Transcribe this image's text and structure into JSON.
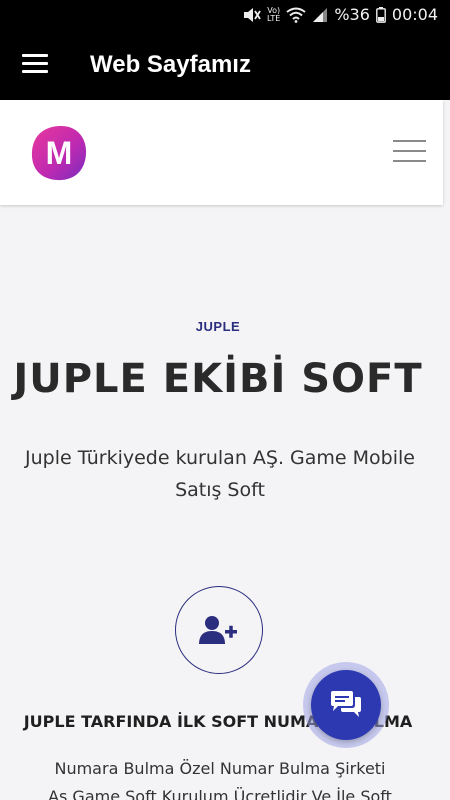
{
  "status_bar": {
    "battery_percent": "%36",
    "time": "00:04",
    "volte_top": "Vo)",
    "volte_bottom": "LTE"
  },
  "app_bar": {
    "title": "Web Sayfamız"
  },
  "site": {
    "logo_letter": "M",
    "eyebrow": "JUPLE",
    "hero_title": "JUPLE EKİBİ SOFT",
    "hero_text": "Juple Türkiyede kurulan AŞ. Game Mobile Satış Soft",
    "feature_title": "JUPLE TARFINDA İLK SOFT NUMARA BULMA",
    "feature_text_line1": "Numara Bulma Özel Numar Bulma Şirketi",
    "feature_text_line2": "As Game Soft Kurulum Ücretlidir Ve İle Soft"
  },
  "colors": {
    "app_bar_bg": "#000000",
    "accent_navy": "#2b2e7e",
    "fab_blue": "#2d39b0",
    "page_bg": "#f4f4f6",
    "logo_gradient_start": "#e0319a",
    "logo_gradient_end": "#7b2cbf"
  },
  "icons": {
    "status": [
      "mute-icon",
      "wifi-icon",
      "signal-icon",
      "battery-icon"
    ],
    "app_bar_menu": "menu-icon",
    "site_menu": "hamburger-icon",
    "feature": "user-add-icon",
    "fab": "chat-icon"
  }
}
